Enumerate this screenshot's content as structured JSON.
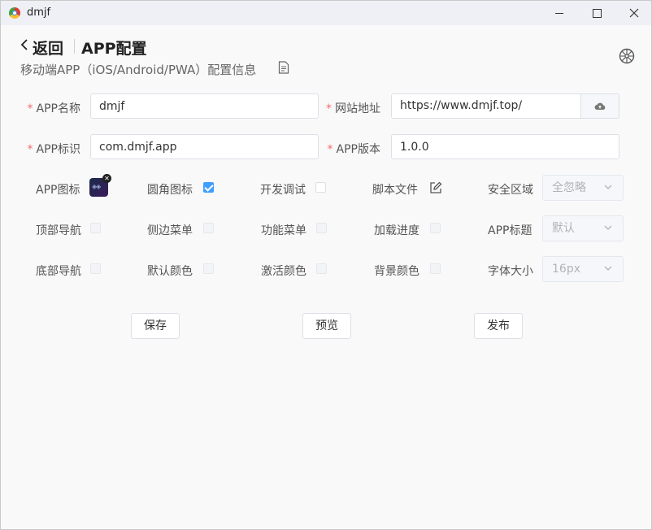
{
  "window": {
    "title": "dmjf"
  },
  "header": {
    "back_label": "返回",
    "title": "APP配置",
    "subtitle": "移动端APP（iOS/Android/PWA）配置信息"
  },
  "form": {
    "app_name": {
      "label": "APP名称",
      "value": "dmjf"
    },
    "site_url": {
      "label": "网站地址",
      "value": "https://www.dmjf.top/"
    },
    "app_id": {
      "label": "APP标识",
      "value": "com.dmjf.app"
    },
    "app_version": {
      "label": "APP版本",
      "value": "1.0.0"
    }
  },
  "options": {
    "app_icon": {
      "label": "APP图标"
    },
    "rounded_icon": {
      "label": "圆角图标",
      "checked": true
    },
    "dev_debug": {
      "label": "开发调试",
      "checked": false
    },
    "script_file": {
      "label": "脚本文件"
    },
    "safe_area": {
      "label": "安全区域",
      "value": "全忽略"
    },
    "top_nav": {
      "label": "顶部导航",
      "checked": false
    },
    "side_menu": {
      "label": "侧边菜单",
      "checked": false
    },
    "func_menu": {
      "label": "功能菜单",
      "checked": false
    },
    "load_progress": {
      "label": "加载进度",
      "checked": false
    },
    "app_title": {
      "label": "APP标题",
      "value": "默认"
    },
    "bottom_nav": {
      "label": "底部导航",
      "checked": false
    },
    "default_color": {
      "label": "默认颜色",
      "checked": false
    },
    "active_color": {
      "label": "激活颜色",
      "checked": false
    },
    "bg_color": {
      "label": "背景颜色",
      "checked": false
    },
    "font_size": {
      "label": "字体大小",
      "value": "16px"
    }
  },
  "actions": {
    "save": "保存",
    "preview": "预览",
    "publish": "发布"
  },
  "colors": {
    "accent": "#409eff",
    "required": "#f56c6c"
  }
}
